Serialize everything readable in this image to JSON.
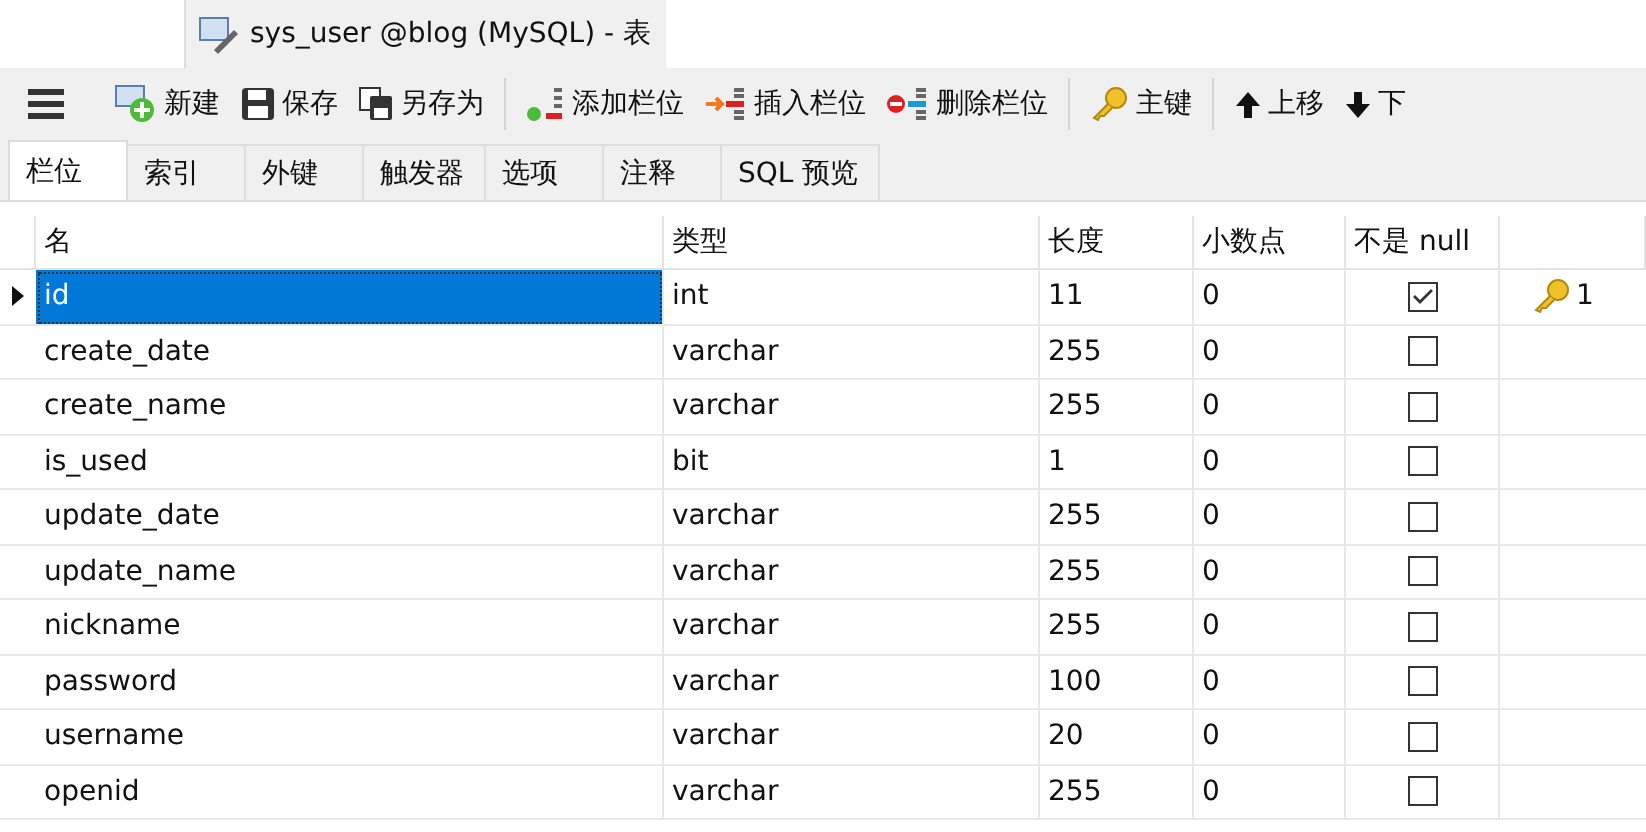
{
  "document_tab": {
    "title": "sys_user @blog (MySQL) - 表",
    "selected": true
  },
  "toolbar": [
    {
      "kind": "menu"
    },
    {
      "kind": "new",
      "label": "新建"
    },
    {
      "kind": "save",
      "label": "保存"
    },
    {
      "kind": "saveas",
      "label": "另存为"
    },
    {
      "kind": "sep"
    },
    {
      "kind": "addcol",
      "label": "添加栏位"
    },
    {
      "kind": "insertcol",
      "label": "插入栏位"
    },
    {
      "kind": "deletecol",
      "label": "删除栏位"
    },
    {
      "kind": "sep"
    },
    {
      "kind": "key",
      "label": "主键"
    },
    {
      "kind": "sep"
    },
    {
      "kind": "up",
      "label": "上移"
    },
    {
      "kind": "down",
      "label": "下"
    }
  ],
  "tabs": [
    {
      "label": "栏位",
      "selected": true
    },
    {
      "label": "索引",
      "selected": false
    },
    {
      "label": "外键",
      "selected": false
    },
    {
      "label": "触发器",
      "selected": false
    },
    {
      "label": "选项",
      "selected": false
    },
    {
      "label": "注释",
      "selected": false
    },
    {
      "label": "SQL 预览",
      "selected": false
    }
  ],
  "table": {
    "columns": [
      "名",
      "类型",
      "长度",
      "小数点",
      "不是 null"
    ],
    "rows": [
      {
        "name": "id",
        "type": "int",
        "length": "11",
        "decimals": "0",
        "not_null": true,
        "key": "1",
        "selected": true
      },
      {
        "name": "create_date",
        "type": "varchar",
        "length": "255",
        "decimals": "0",
        "not_null": false,
        "selected": false
      },
      {
        "name": "create_name",
        "type": "varchar",
        "length": "255",
        "decimals": "0",
        "not_null": false,
        "selected": false
      },
      {
        "name": "is_used",
        "type": "bit",
        "length": "1",
        "decimals": "0",
        "not_null": false,
        "selected": false
      },
      {
        "name": "update_date",
        "type": "varchar",
        "length": "255",
        "decimals": "0",
        "not_null": false,
        "selected": false
      },
      {
        "name": "update_name",
        "type": "varchar",
        "length": "255",
        "decimals": "0",
        "not_null": false,
        "selected": false
      },
      {
        "name": "nickname",
        "type": "varchar",
        "length": "255",
        "decimals": "0",
        "not_null": false,
        "selected": false
      },
      {
        "name": "password",
        "type": "varchar",
        "length": "100",
        "decimals": "0",
        "not_null": false,
        "selected": false
      },
      {
        "name": "username",
        "type": "varchar",
        "length": "20",
        "decimals": "0",
        "not_null": false,
        "selected": false
      },
      {
        "name": "openid",
        "type": "varchar",
        "length": "255",
        "decimals": "0",
        "not_null": false,
        "selected": false
      }
    ]
  }
}
